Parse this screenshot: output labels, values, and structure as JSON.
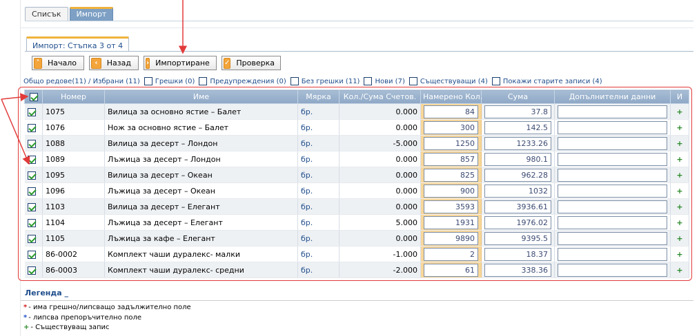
{
  "tabs": [
    {
      "label": "Списък"
    },
    {
      "label": "Импорт"
    }
  ],
  "step_tab": "Импорт: Стъпка 3 от 4",
  "buttons": {
    "start": "Начало",
    "back": "Назад",
    "import": "Импортиране",
    "check": "Проверка"
  },
  "filters": {
    "summary": "Общо редове(11) / Избрани (11)",
    "errors": "Грешки (0)",
    "warnings": "Предупреждения (0)",
    "no_errors": "Без грешки (11)",
    "new": "Нови (7)",
    "existing": "Съществуващи (4)",
    "show_old": "Покажи старите записи (4)"
  },
  "grid": {
    "columns": [
      "Номер",
      "Име",
      "Мярка",
      "Кол./Сума Счетов.",
      "Намерено Кол.",
      "Сума",
      "Допълнителни данни",
      "И"
    ],
    "rows": [
      {
        "num": "1075",
        "name": "Вилица за основно ястие – Балет",
        "unit": "бр.",
        "acct": "0.000",
        "found": "84",
        "sum": "37.8",
        "extra": "",
        "flag": "+"
      },
      {
        "num": "1076",
        "name": "Нож за основно ястие – Балет",
        "unit": "бр.",
        "acct": "0.000",
        "found": "300",
        "sum": "142.5",
        "extra": "",
        "flag": "+"
      },
      {
        "num": "1088",
        "name": "Вилица за десерт – Лондон",
        "unit": "бр.",
        "acct": "-5.000",
        "found": "1250",
        "sum": "1233.26",
        "extra": "",
        "flag": "+"
      },
      {
        "num": "1089",
        "name": "Лъжица за десерт – Лондон",
        "unit": "бр.",
        "acct": "0.000",
        "found": "857",
        "sum": "980.1",
        "extra": "",
        "flag": "+"
      },
      {
        "num": "1095",
        "name": "Вилица за десерт – Океан",
        "unit": "бр.",
        "acct": "0.000",
        "found": "825",
        "sum": "962.28",
        "extra": "",
        "flag": "+"
      },
      {
        "num": "1096",
        "name": "Лъжица за десерт – Океан",
        "unit": "бр.",
        "acct": "0.000",
        "found": "900",
        "sum": "1032",
        "extra": "",
        "flag": "+"
      },
      {
        "num": "1103",
        "name": "Вилица за десерт – Елегант",
        "unit": "бр.",
        "acct": "0.000",
        "found": "3593",
        "sum": "3936.61",
        "extra": "",
        "flag": "+"
      },
      {
        "num": "1104",
        "name": "Лъжица за десерт – Елегант",
        "unit": "бр.",
        "acct": "5.000",
        "found": "1931",
        "sum": "1976.02",
        "extra": "",
        "flag": "+"
      },
      {
        "num": "1105",
        "name": "Лъжица за кафе – Елегант",
        "unit": "бр.",
        "acct": "0.000",
        "found": "9890",
        "sum": "9395.5",
        "extra": "",
        "flag": "+"
      },
      {
        "num": "86-0002",
        "name": "Комплект чаши дуралекс- малки",
        "unit": "бр.",
        "acct": "-1.000",
        "found": "2",
        "sum": "18.37",
        "extra": "",
        "flag": "+"
      },
      {
        "num": "86-0003",
        "name": "Комплект чаши дуралекс- средни",
        "unit": "бр.",
        "acct": "-2.000",
        "found": "61",
        "sum": "338.36",
        "extra": "",
        "flag": "+"
      }
    ]
  },
  "legend": {
    "title": "Легенда _",
    "items": [
      {
        "sym": "*",
        "color": "#d42020",
        "text": "- има грешно/липсващо задължително поле"
      },
      {
        "sym": "*",
        "color": "#1f4fc8",
        "text": "- липсва препоръчително поле"
      },
      {
        "sym": "+",
        "color": "#2a8a2a",
        "text": "- Съществуващ запис"
      }
    ]
  },
  "colors": {
    "accent": "#f0b23a",
    "header": "#8ea8c6",
    "link": "#1f4d8c",
    "annotation": "#e23a3a"
  }
}
